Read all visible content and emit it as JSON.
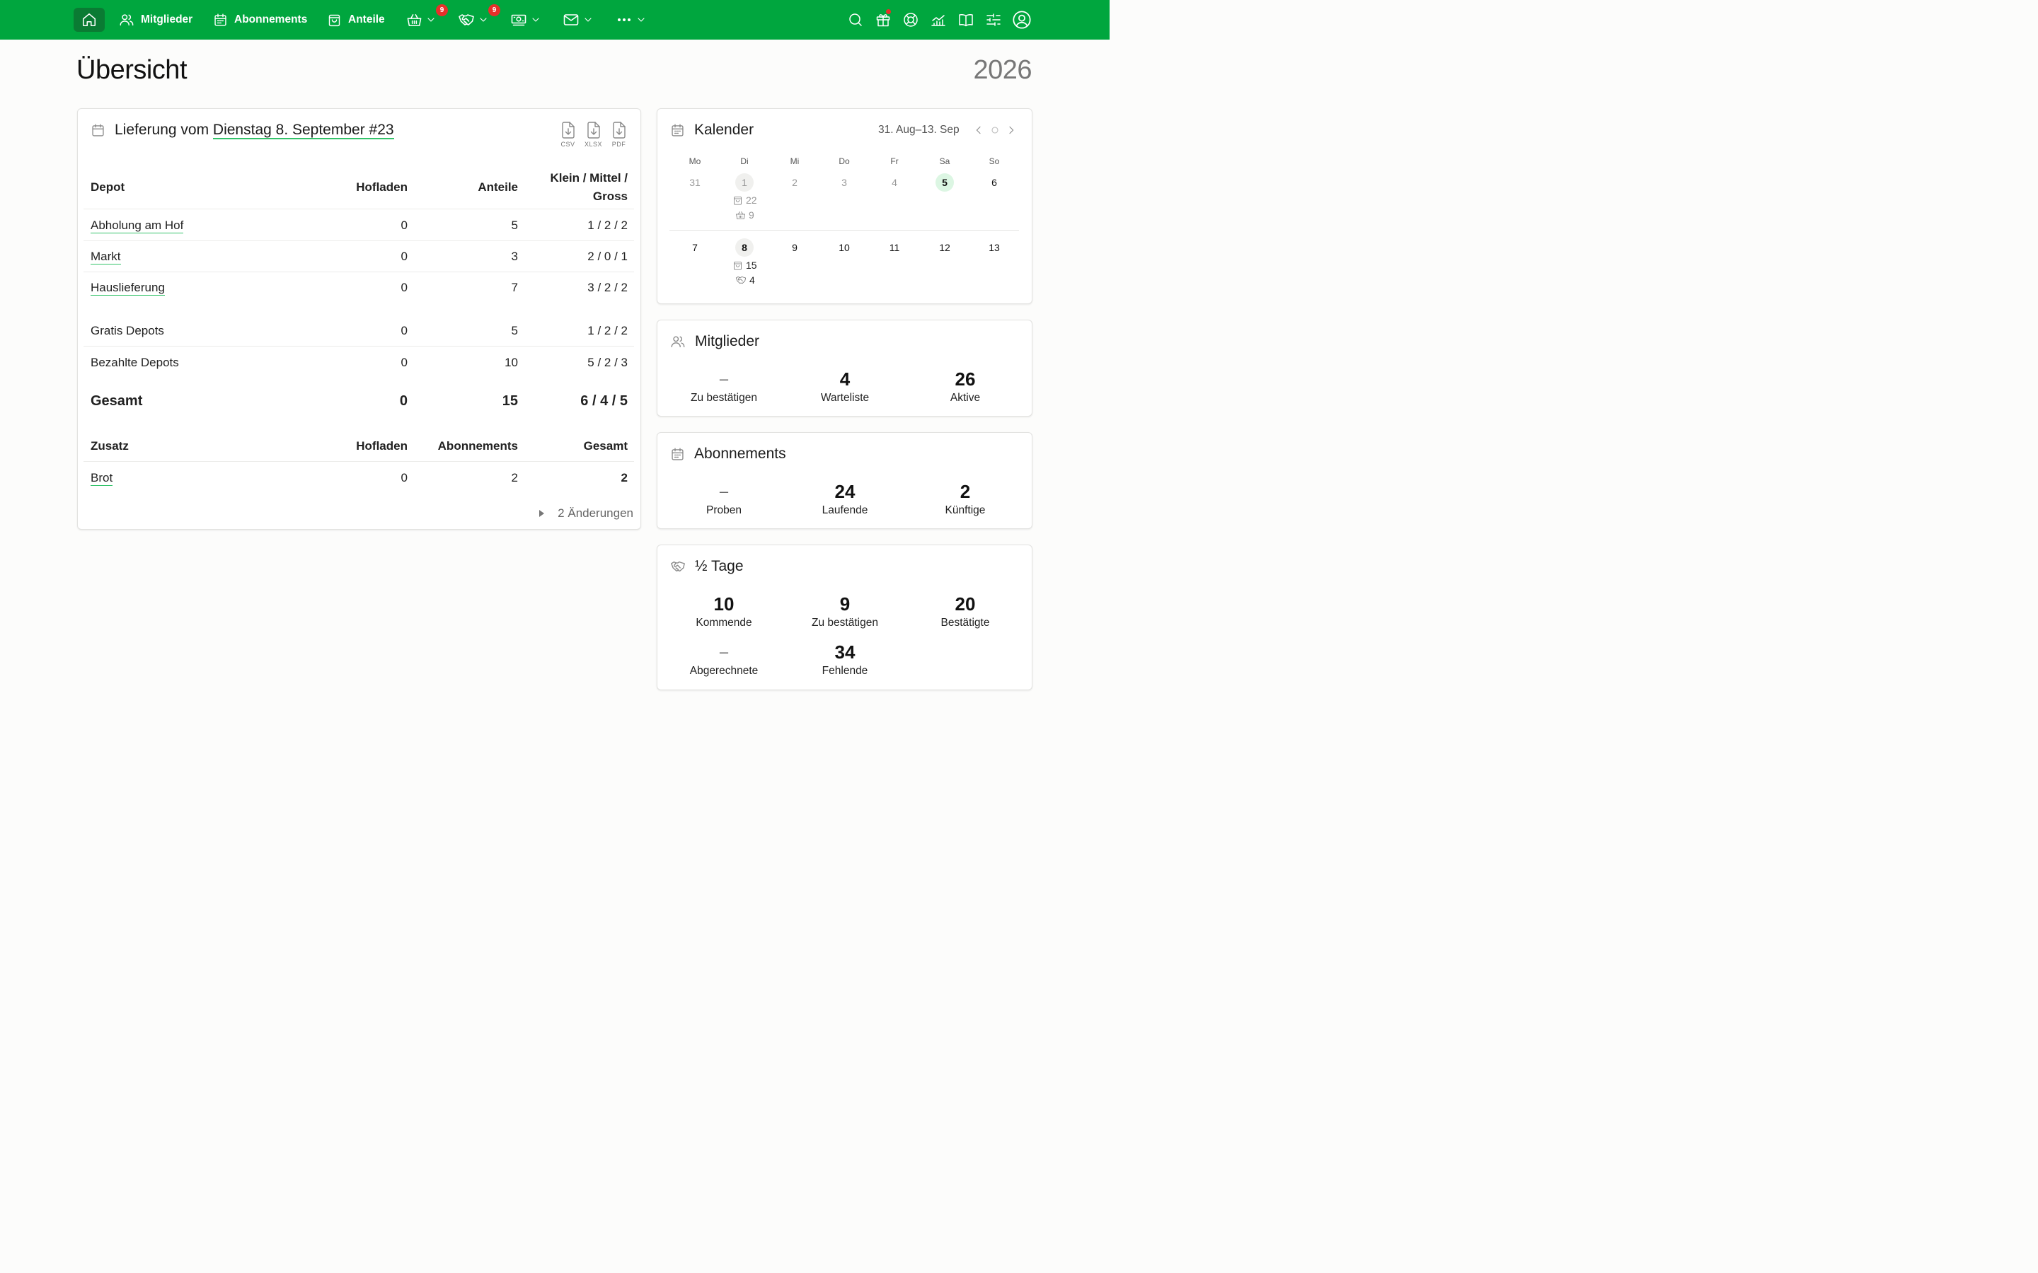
{
  "nav": {
    "home_icon": "home-icon",
    "members": "Mitglieder",
    "subscriptions": "Abonnements",
    "shares": "Anteile",
    "basket_badge": "9",
    "halfday_badge": "9",
    "right_icons": [
      "search-icon",
      "gift-icon",
      "lifebuoy-icon",
      "chart-icon",
      "book-icon",
      "sliders-icon",
      "user-icon"
    ]
  },
  "page": {
    "title": "Übersicht",
    "year": "2026"
  },
  "delivery": {
    "prefix": "Lieferung vom ",
    "link": "Dienstag 8. September #23",
    "downloads": [
      "CSV",
      "XLSX",
      "PDF"
    ],
    "headers": {
      "depot": "Depot",
      "farmshop": "Hofladen",
      "shares": "Anteile",
      "sizes_1": "Klein / Mittel /",
      "sizes_2": "Gross"
    },
    "rows": [
      {
        "name": "Abholung am Hof",
        "farmshop": "0",
        "shares": "5",
        "sizes": "1 / 2 / 2"
      },
      {
        "name": "Markt",
        "farmshop": "0",
        "shares": "3",
        "sizes": "2 / 0 / 1"
      },
      {
        "name": "Hauslieferung",
        "farmshop": "0",
        "shares": "7",
        "sizes": "3 / 2 / 2"
      }
    ],
    "free": {
      "name": "Gratis Depots",
      "farmshop": "0",
      "shares": "5",
      "sizes": "1 / 2 / 2"
    },
    "paid": {
      "name": "Bezahlte Depots",
      "farmshop": "0",
      "shares": "10",
      "sizes": "5 / 2 / 3"
    },
    "total": {
      "name": "Gesamt",
      "farmshop": "0",
      "shares": "15",
      "sizes": "6 / 4 / 5"
    },
    "extra_headers": {
      "extra": "Zusatz",
      "farmshop": "Hofladen",
      "subscriptions": "Abonnements",
      "total": "Gesamt"
    },
    "extra_rows": [
      {
        "name": "Brot",
        "farmshop": "0",
        "subscriptions": "2",
        "total": "2"
      }
    ],
    "changes": "2 Änderungen"
  },
  "calendar": {
    "title": "Kalender",
    "range": "31. Aug–13. Sep",
    "weekdays": [
      "Mo",
      "Di",
      "Mi",
      "Do",
      "Fr",
      "Sa",
      "So"
    ],
    "week1": [
      "31",
      "1",
      "2",
      "3",
      "4",
      "5",
      "6"
    ],
    "week2": [
      "7",
      "8",
      "9",
      "10",
      "11",
      "12",
      "13"
    ],
    "events": {
      "w1_bag": "22",
      "w1_basket": "9",
      "w2_bag": "15",
      "w2_handshake": "4"
    }
  },
  "members": {
    "title": "Mitglieder",
    "stats": [
      {
        "value": "–",
        "label": "Zu bestätigen"
      },
      {
        "value": "4",
        "label": "Warteliste"
      },
      {
        "value": "26",
        "label": "Aktive"
      }
    ]
  },
  "subscriptions": {
    "title": "Abonnements",
    "stats": [
      {
        "value": "–",
        "label": "Proben"
      },
      {
        "value": "24",
        "label": "Laufende"
      },
      {
        "value": "2",
        "label": "Künftige"
      }
    ]
  },
  "halfdays": {
    "title": "½ Tage",
    "stats": [
      {
        "value": "10",
        "label": "Kommende"
      },
      {
        "value": "9",
        "label": "Zu bestätigen"
      },
      {
        "value": "20",
        "label": "Bestätigte"
      },
      {
        "value": "–",
        "label": "Abgerechnete"
      },
      {
        "value": "34",
        "label": "Fehlende"
      }
    ]
  }
}
